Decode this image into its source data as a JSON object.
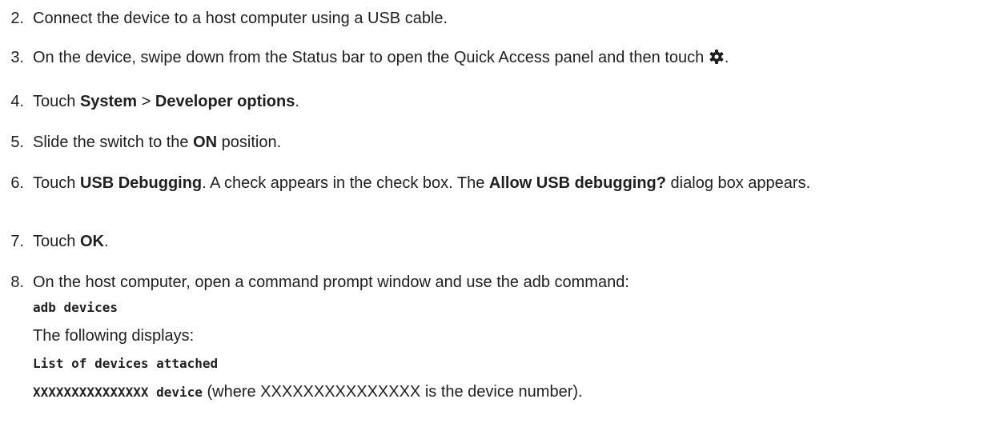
{
  "steps": [
    {
      "num": "2.",
      "text": "Connect the device to a host computer using a USB cable."
    },
    {
      "num": "3.",
      "text_before": "On the device, swipe down from the Status bar to open the Quick Access panel and then touch ",
      "icon": "settings-gear-icon",
      "text_after": "."
    },
    {
      "num": "4.",
      "prefix": "Touch ",
      "bold1": "System",
      "sep": " > ",
      "bold2": "Developer options",
      "suffix": "."
    },
    {
      "num": "5.",
      "prefix": "Slide the switch to the ",
      "bold": "ON",
      "suffix": " position."
    },
    {
      "num": "6.",
      "prefix": "Touch ",
      "bold1": "USB Debugging",
      "middle": ". A check appears in the check box. The ",
      "bold2": "Allow USB debugging?",
      "suffix": " dialog box appears."
    },
    {
      "num": "7.",
      "prefix": "Touch ",
      "bold": "OK",
      "suffix": "."
    },
    {
      "num": "8.",
      "text": "On the host computer, open a command prompt window and use the adb command:",
      "command": "adb devices",
      "following": "The following displays:",
      "output_line1": "List of devices attached",
      "output_line2_code": "XXXXXXXXXXXXXXX device",
      "output_line2_text": " (where XXXXXXXXXXXXXXX is the device number)."
    }
  ],
  "colors": {
    "text": "#1f1f1f",
    "background": "#ffffff"
  }
}
